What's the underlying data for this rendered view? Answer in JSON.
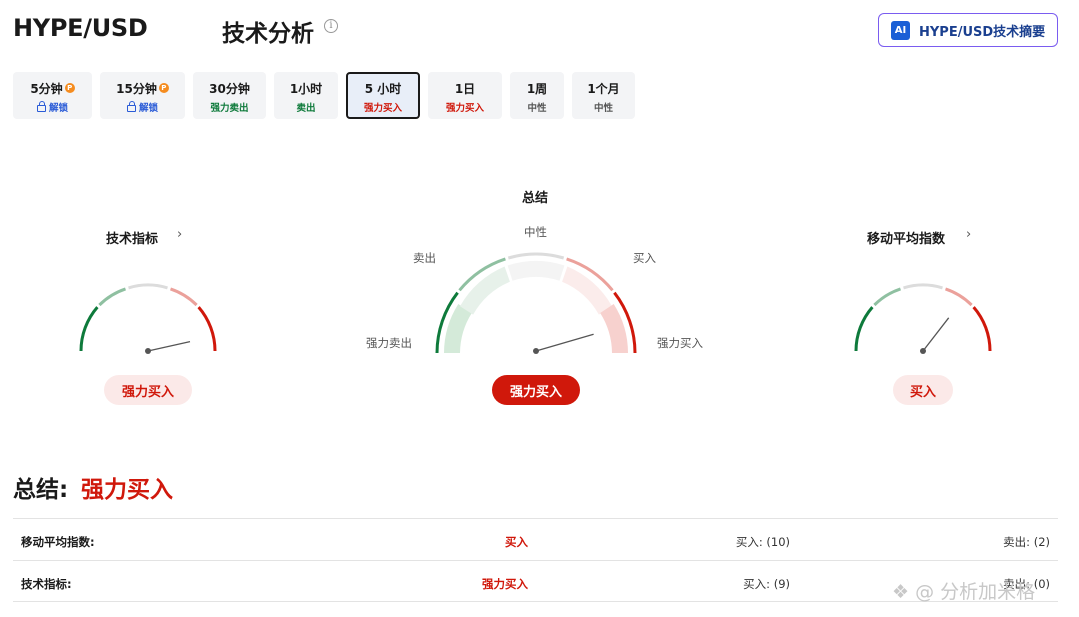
{
  "header": {
    "pair": "HYPE/USD",
    "title": "技术分析",
    "info_icon": "i",
    "ai_badge": "AI",
    "ai_button": "HYPE/USD技术摘要"
  },
  "tabs": [
    {
      "name": "5分钟",
      "sub": "解锁",
      "tone": "blue",
      "premium": true
    },
    {
      "name": "15分钟",
      "sub": "解锁",
      "tone": "blue",
      "premium": true
    },
    {
      "name": "30分钟",
      "sub": "强力卖出",
      "tone": "green"
    },
    {
      "name": "1小时",
      "sub": "卖出",
      "tone": "green"
    },
    {
      "name": "5 小时",
      "sub": "强力买入",
      "tone": "red",
      "active": true
    },
    {
      "name": "1日",
      "sub": "强力买入",
      "tone": "red"
    },
    {
      "name": "1周",
      "sub": "中性",
      "tone": "gray"
    },
    {
      "name": "1个月",
      "sub": "中性",
      "tone": "gray"
    }
  ],
  "premium_icon": "P",
  "gauges": {
    "technical": {
      "title": "技术指标",
      "result": "强力买入",
      "needle_position": 0.93
    },
    "summary": {
      "title": "总结",
      "labels": {
        "strong_sell": "强力卖出",
        "sell": "卖出",
        "neutral": "中性",
        "buy": "买入",
        "strong_buy": "强力买入"
      },
      "result": "强力买入",
      "needle_position": 0.91
    },
    "moving_average": {
      "title": "移动平均指数",
      "result": "买入",
      "needle_position": 0.71
    }
  },
  "chevron": "›",
  "summary": {
    "heading": "总结:",
    "value": "强力买入"
  },
  "table": [
    {
      "name": "移动平均指数:",
      "value": "买入",
      "buy": "买入: (10)",
      "sell": "卖出: (2)"
    },
    {
      "name": "技术指标:",
      "value": "强力买入",
      "buy": "买入: (9)",
      "sell": "卖出: (0)"
    }
  ],
  "watermark": "❖ @ 分析加米格",
  "colors": {
    "buy": "#d0180b",
    "sell": "#0e7a3b",
    "accent": "#7a5cf0",
    "brand_blue": "#1a5fd6"
  }
}
